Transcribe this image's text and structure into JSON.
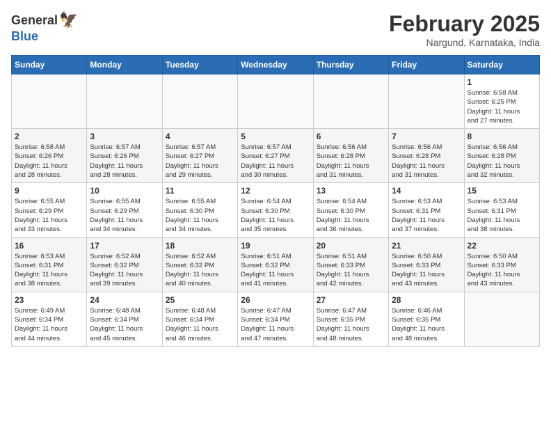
{
  "header": {
    "logo_general": "General",
    "logo_blue": "Blue",
    "month_title": "February 2025",
    "location": "Nargund, Karnataka, India"
  },
  "days_of_week": [
    "Sunday",
    "Monday",
    "Tuesday",
    "Wednesday",
    "Thursday",
    "Friday",
    "Saturday"
  ],
  "weeks": [
    [
      {
        "day": "",
        "info": ""
      },
      {
        "day": "",
        "info": ""
      },
      {
        "day": "",
        "info": ""
      },
      {
        "day": "",
        "info": ""
      },
      {
        "day": "",
        "info": ""
      },
      {
        "day": "",
        "info": ""
      },
      {
        "day": "1",
        "info": "Sunrise: 6:58 AM\nSunset: 6:25 PM\nDaylight: 11 hours\nand 27 minutes."
      }
    ],
    [
      {
        "day": "2",
        "info": "Sunrise: 6:58 AM\nSunset: 6:26 PM\nDaylight: 11 hours\nand 28 minutes."
      },
      {
        "day": "3",
        "info": "Sunrise: 6:57 AM\nSunset: 6:26 PM\nDaylight: 11 hours\nand 28 minutes."
      },
      {
        "day": "4",
        "info": "Sunrise: 6:57 AM\nSunset: 6:27 PM\nDaylight: 11 hours\nand 29 minutes."
      },
      {
        "day": "5",
        "info": "Sunrise: 6:57 AM\nSunset: 6:27 PM\nDaylight: 11 hours\nand 30 minutes."
      },
      {
        "day": "6",
        "info": "Sunrise: 6:56 AM\nSunset: 6:28 PM\nDaylight: 11 hours\nand 31 minutes."
      },
      {
        "day": "7",
        "info": "Sunrise: 6:56 AM\nSunset: 6:28 PM\nDaylight: 11 hours\nand 31 minutes."
      },
      {
        "day": "8",
        "info": "Sunrise: 6:56 AM\nSunset: 6:28 PM\nDaylight: 11 hours\nand 32 minutes."
      }
    ],
    [
      {
        "day": "9",
        "info": "Sunrise: 6:55 AM\nSunset: 6:29 PM\nDaylight: 11 hours\nand 33 minutes."
      },
      {
        "day": "10",
        "info": "Sunrise: 6:55 AM\nSunset: 6:29 PM\nDaylight: 11 hours\nand 34 minutes."
      },
      {
        "day": "11",
        "info": "Sunrise: 6:55 AM\nSunset: 6:30 PM\nDaylight: 11 hours\nand 34 minutes."
      },
      {
        "day": "12",
        "info": "Sunrise: 6:54 AM\nSunset: 6:30 PM\nDaylight: 11 hours\nand 35 minutes."
      },
      {
        "day": "13",
        "info": "Sunrise: 6:54 AM\nSunset: 6:30 PM\nDaylight: 11 hours\nand 36 minutes."
      },
      {
        "day": "14",
        "info": "Sunrise: 6:53 AM\nSunset: 6:31 PM\nDaylight: 11 hours\nand 37 minutes."
      },
      {
        "day": "15",
        "info": "Sunrise: 6:53 AM\nSunset: 6:31 PM\nDaylight: 11 hours\nand 38 minutes."
      }
    ],
    [
      {
        "day": "16",
        "info": "Sunrise: 6:53 AM\nSunset: 6:31 PM\nDaylight: 11 hours\nand 38 minutes."
      },
      {
        "day": "17",
        "info": "Sunrise: 6:52 AM\nSunset: 6:32 PM\nDaylight: 11 hours\nand 39 minutes."
      },
      {
        "day": "18",
        "info": "Sunrise: 6:52 AM\nSunset: 6:32 PM\nDaylight: 11 hours\nand 40 minutes."
      },
      {
        "day": "19",
        "info": "Sunrise: 6:51 AM\nSunset: 6:32 PM\nDaylight: 11 hours\nand 41 minutes."
      },
      {
        "day": "20",
        "info": "Sunrise: 6:51 AM\nSunset: 6:33 PM\nDaylight: 11 hours\nand 42 minutes."
      },
      {
        "day": "21",
        "info": "Sunrise: 6:50 AM\nSunset: 6:33 PM\nDaylight: 11 hours\nand 43 minutes."
      },
      {
        "day": "22",
        "info": "Sunrise: 6:50 AM\nSunset: 6:33 PM\nDaylight: 11 hours\nand 43 minutes."
      }
    ],
    [
      {
        "day": "23",
        "info": "Sunrise: 6:49 AM\nSunset: 6:34 PM\nDaylight: 11 hours\nand 44 minutes."
      },
      {
        "day": "24",
        "info": "Sunrise: 6:48 AM\nSunset: 6:34 PM\nDaylight: 11 hours\nand 45 minutes."
      },
      {
        "day": "25",
        "info": "Sunrise: 6:48 AM\nSunset: 6:34 PM\nDaylight: 11 hours\nand 46 minutes."
      },
      {
        "day": "26",
        "info": "Sunrise: 6:47 AM\nSunset: 6:34 PM\nDaylight: 11 hours\nand 47 minutes."
      },
      {
        "day": "27",
        "info": "Sunrise: 6:47 AM\nSunset: 6:35 PM\nDaylight: 11 hours\nand 48 minutes."
      },
      {
        "day": "28",
        "info": "Sunrise: 6:46 AM\nSunset: 6:35 PM\nDaylight: 11 hours\nand 48 minutes."
      },
      {
        "day": "",
        "info": ""
      }
    ]
  ]
}
